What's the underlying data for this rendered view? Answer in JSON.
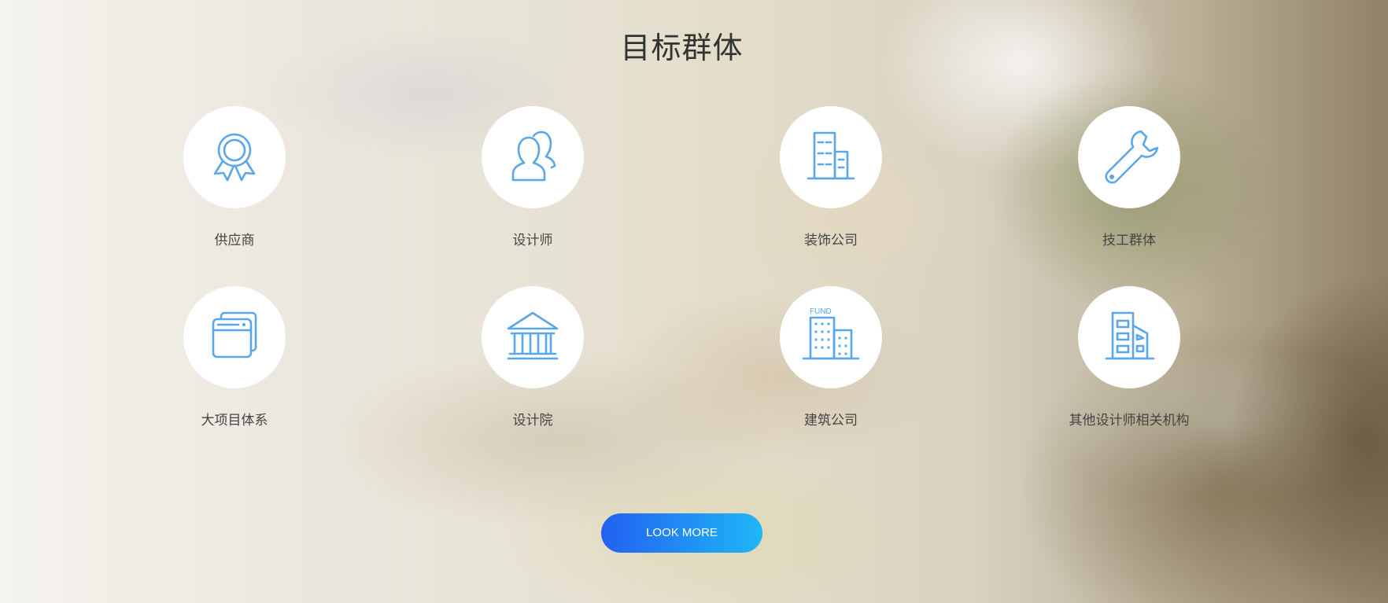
{
  "section": {
    "title": "目标群体"
  },
  "groups": [
    {
      "label": "供应商",
      "icon": "award-ribbon-icon"
    },
    {
      "label": "设计师",
      "icon": "users-icon"
    },
    {
      "label": "装饰公司",
      "icon": "office-building-icon"
    },
    {
      "label": "技工群体",
      "icon": "wrench-icon"
    },
    {
      "label": "大项目体系",
      "icon": "stacked-windows-icon"
    },
    {
      "label": "设计院",
      "icon": "institution-icon"
    },
    {
      "label": "建筑公司",
      "icon": "fund-building-icon"
    },
    {
      "label": "其他设计师相关机构",
      "icon": "tower-building-icon"
    }
  ],
  "cta": {
    "label": "LOOK MORE"
  },
  "colors": {
    "icon": "#5aa6ea",
    "button_start": "#2261f0",
    "button_end": "#1fb7f7",
    "title": "#333333"
  }
}
